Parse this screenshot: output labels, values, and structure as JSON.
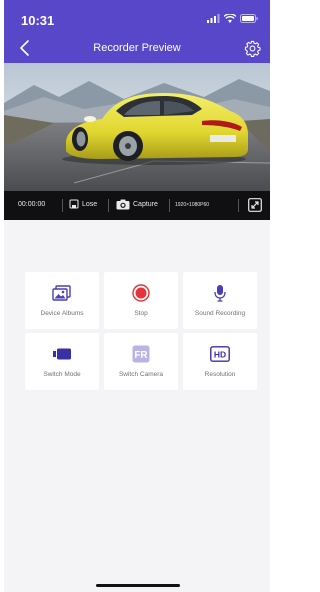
{
  "status": {
    "time": "10:31"
  },
  "nav": {
    "title": "Recorder Preview"
  },
  "toolbar": {
    "elapsed": "00:00:00",
    "lose_label": "Lose",
    "capture_label": "Capture",
    "resolution": "1920×1080P60"
  },
  "controls": {
    "device_albums": "Device Albums",
    "stop": "Stop",
    "sound_recording": "Sound Recording",
    "switch_mode": "Switch Mode",
    "switch_camera": "Switch Camera",
    "camera_badge": "FR",
    "resolution": "Resolution",
    "resolution_badge": "HD"
  },
  "colors": {
    "accent": "#5847c9",
    "stop": "#e5323b",
    "camera_badge": "#b9b3e6"
  },
  "icons": [
    "back-icon",
    "settings-gear-icon",
    "save-icon",
    "camera-icon",
    "expand-icon",
    "photo-album-icon",
    "stop-record-icon",
    "microphone-icon",
    "video-camera-icon",
    "switch-camera-icon",
    "hd-icon"
  ]
}
